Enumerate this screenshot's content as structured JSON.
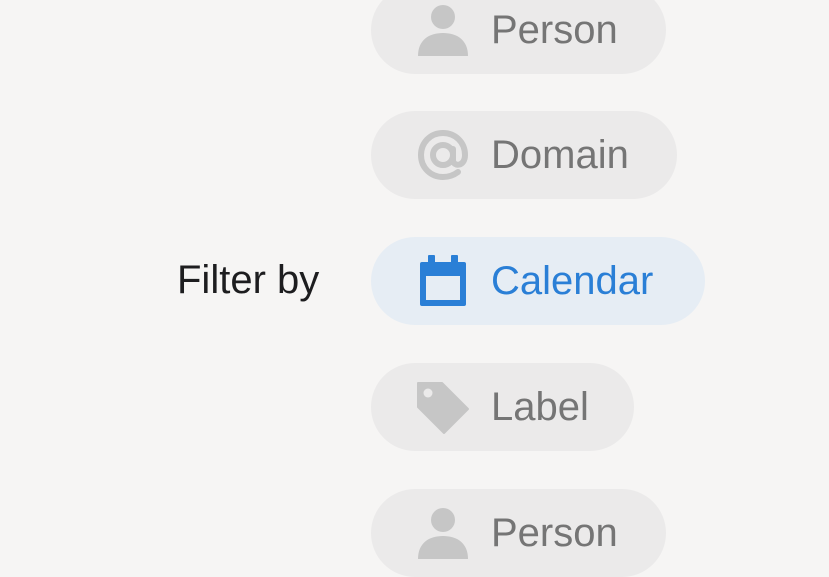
{
  "filter": {
    "heading": "Filter by",
    "options": [
      {
        "label": "Person",
        "icon": "person-icon",
        "active": false
      },
      {
        "label": "Domain",
        "icon": "at-sign-icon",
        "active": false
      },
      {
        "label": "Calendar",
        "icon": "calendar-icon",
        "active": true
      },
      {
        "label": "Label",
        "icon": "tag-icon",
        "active": false
      },
      {
        "label": "Person",
        "icon": "person-icon",
        "active": false
      }
    ]
  },
  "colors": {
    "background": "#f6f5f4",
    "pill_inactive": "#ebeaea",
    "pill_active": "#e6edf4",
    "text_inactive": "#757575",
    "icon_inactive": "#c6c6c6",
    "accent": "#2a7fd6",
    "heading_text": "#1d1d1f"
  }
}
